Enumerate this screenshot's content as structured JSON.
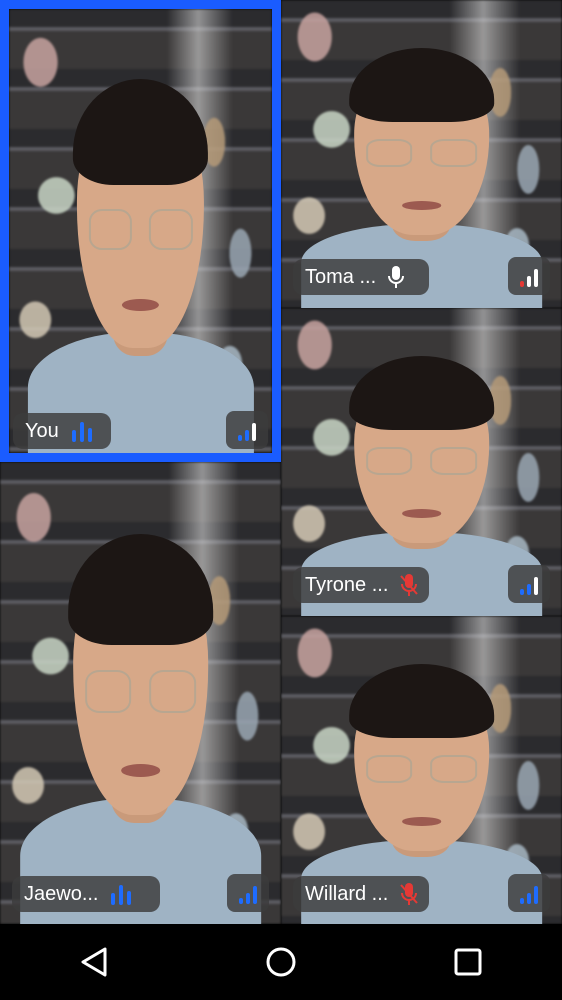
{
  "participants": [
    {
      "name": "You",
      "mic": "speaking",
      "signal": "good"
    },
    {
      "name": "Toma ...",
      "mic": "on",
      "signal": "weak"
    },
    {
      "name": "Tyrone ...",
      "mic": "muted",
      "signal": "good"
    },
    {
      "name": "Jaewo...",
      "mic": "speaking",
      "signal": "good"
    },
    {
      "name": "Willard ...",
      "mic": "muted",
      "signal": "good"
    }
  ],
  "colors": {
    "accent": "#1a5cff",
    "signal_good": "#1e6cff",
    "signal_weak": "#e53935",
    "muted": "#e53935"
  },
  "navbar": {
    "back": "back-icon",
    "home": "home-icon",
    "recents": "recents-icon"
  }
}
